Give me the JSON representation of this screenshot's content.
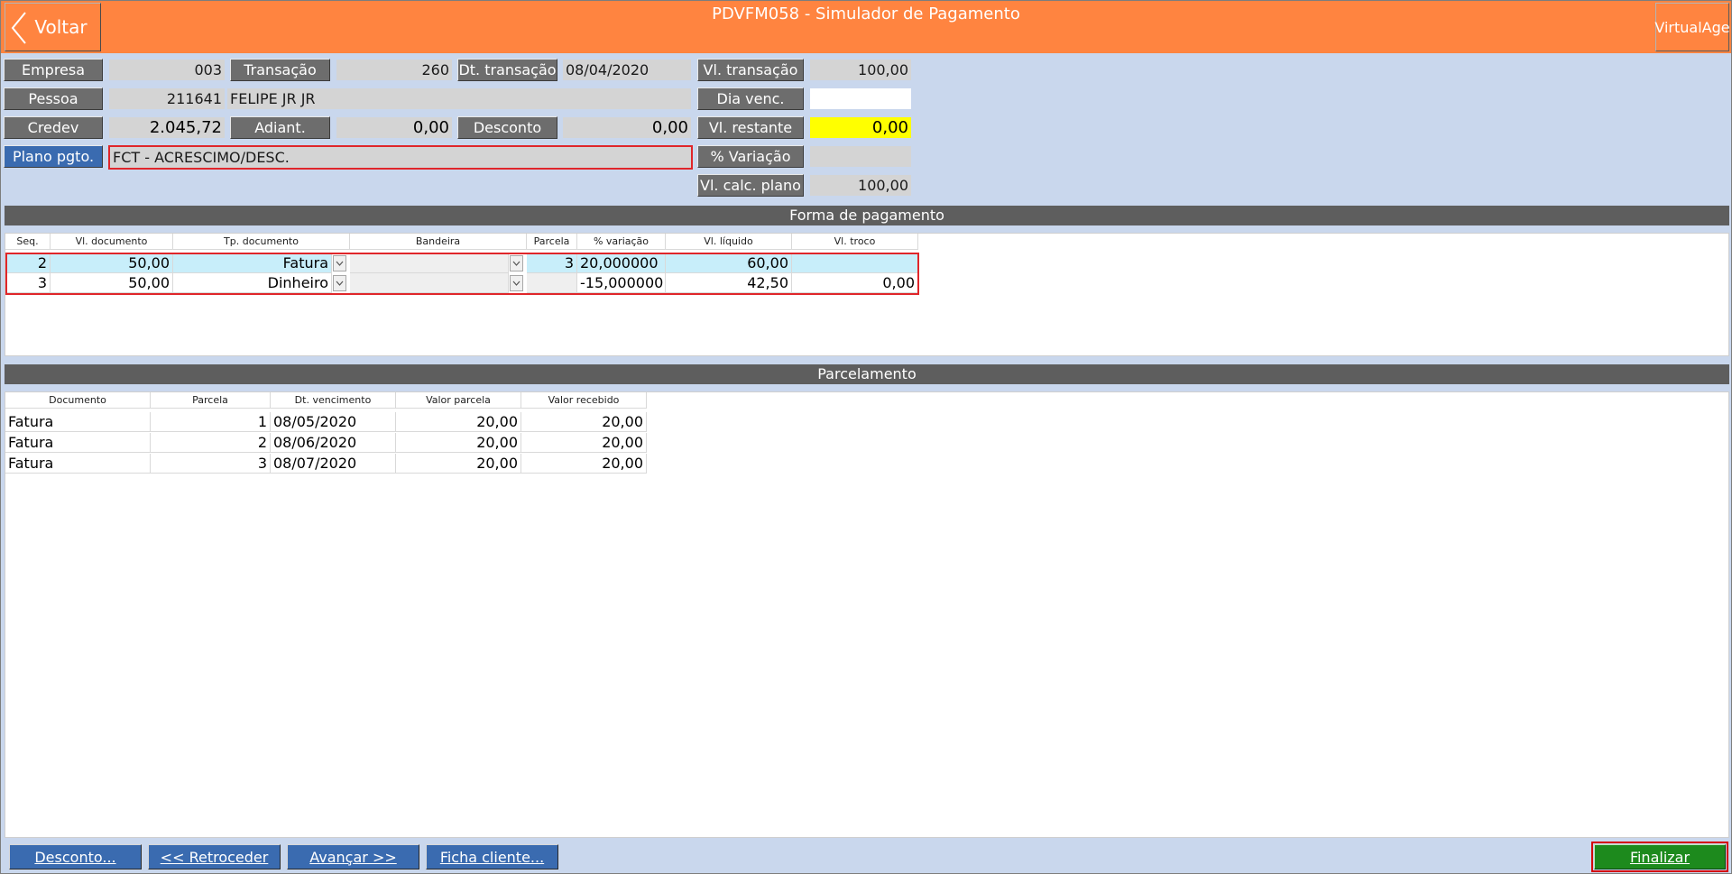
{
  "header": {
    "back_label": "Voltar",
    "title": "PDVFM058 - Simulador de Pagamento",
    "brand": "VirtualAge"
  },
  "form": {
    "empresa_label": "Empresa",
    "empresa_value": "003",
    "transacao_label": "Transação",
    "transacao_value": "260",
    "dt_transacao_label": "Dt. transação",
    "dt_transacao_value": "08/04/2020",
    "vl_transacao_label": "Vl. transação",
    "vl_transacao_value": "100,00",
    "pessoa_label": "Pessoa",
    "pessoa_code": "211641",
    "pessoa_name": "FELIPE JR JR",
    "dia_venc_label": "Dia venc.",
    "dia_venc_value": "",
    "credev_label": "Credev",
    "credev_value": "2.045,72",
    "adiant_label": "Adiant.",
    "adiant_value": "0,00",
    "desconto_label": "Desconto",
    "desconto_value": "0,00",
    "vl_restante_label": "Vl. restante",
    "vl_restante_value": "0,00",
    "plano_label": "Plano pgto.",
    "plano_value": "FCT - ACRESCIMO/DESC.",
    "variacao_label": "% Variação",
    "variacao_value": "",
    "vl_calc_plano_label": "Vl. calc. plano",
    "vl_calc_plano_value": "100,00"
  },
  "forma_pagamento": {
    "title": "Forma de pagamento",
    "columns": [
      "Seq.",
      "Vl. documento",
      "Tp. documento",
      "Bandeira",
      "Parcela",
      "% variação",
      "Vl. líquido",
      "Vl. troco"
    ],
    "rows": [
      {
        "seq": "2",
        "vl_documento": "50,00",
        "tp_documento": "Fatura",
        "bandeira": "",
        "parcela": "3",
        "variacao": "20,000000",
        "vl_liquido": "60,00",
        "vl_troco": ""
      },
      {
        "seq": "3",
        "vl_documento": "50,00",
        "tp_documento": "Dinheiro",
        "bandeira": "",
        "parcela": "",
        "variacao": "-15,000000",
        "vl_liquido": "42,50",
        "vl_troco": "0,00"
      }
    ]
  },
  "parcelamento": {
    "title": "Parcelamento",
    "columns": [
      "Documento",
      "Parcela",
      "Dt. vencimento",
      "Valor parcela",
      "Valor recebido"
    ],
    "rows": [
      {
        "documento": "Fatura",
        "parcela": "1",
        "dt_vencimento": "08/05/2020",
        "valor_parcela": "20,00",
        "valor_recebido": "20,00"
      },
      {
        "documento": "Fatura",
        "parcela": "2",
        "dt_vencimento": "08/06/2020",
        "valor_parcela": "20,00",
        "valor_recebido": "20,00"
      },
      {
        "documento": "Fatura",
        "parcela": "3",
        "dt_vencimento": "08/07/2020",
        "valor_parcela": "20,00",
        "valor_recebido": "20,00"
      }
    ]
  },
  "footer": {
    "desconto_btn": "Desconto...",
    "retroceder_btn": "<< Retroceder",
    "avancar_btn": "Avançar >>",
    "ficha_btn": "Ficha cliente...",
    "finalizar_btn": "Finalizar"
  },
  "colors": {
    "header": "#ff8440",
    "background": "#c9d7ed",
    "label_gray": "#6d6d6d",
    "label_blue": "#3a6bb0",
    "selected_row": "#c8eefa",
    "highlight_yellow": "#ffff00",
    "finalizar_green": "#1d8a1d",
    "red_outline": "#e0262a"
  }
}
